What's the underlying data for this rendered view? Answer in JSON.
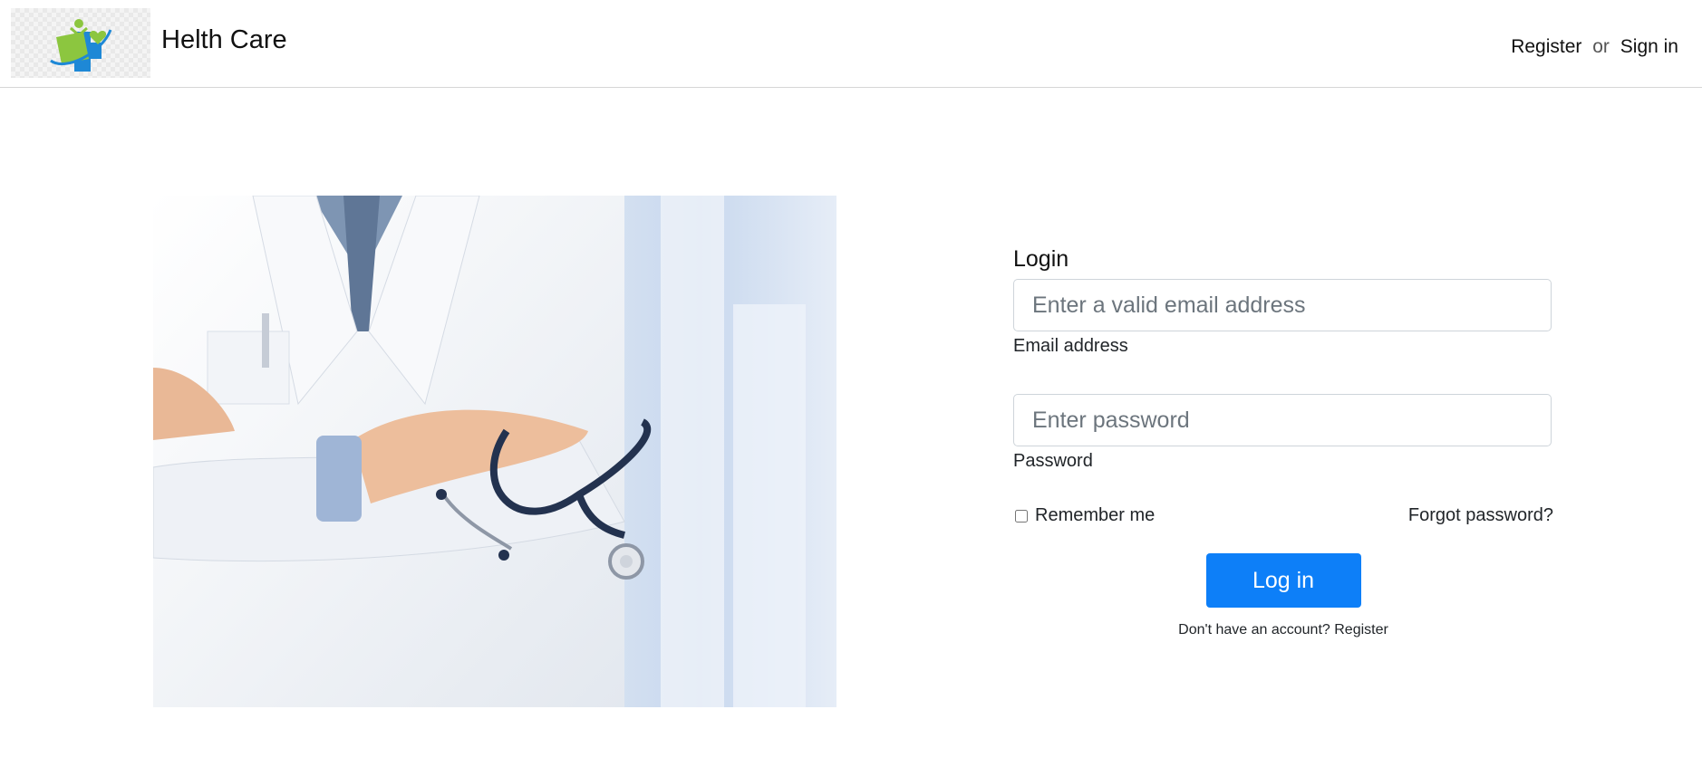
{
  "header": {
    "brand": "Helth Care",
    "nav": {
      "register": "Register",
      "or": "or",
      "sign_in": "Sign in"
    }
  },
  "login": {
    "title": "Login",
    "email": {
      "placeholder": "Enter a valid email address",
      "value": "",
      "label": "Email address"
    },
    "password": {
      "placeholder": "Enter password",
      "value": "",
      "label": "Password"
    },
    "remember_label": "Remember me",
    "remember_checked": false,
    "forgot": "Forgot password?",
    "submit": "Log in",
    "signup_prompt": "Don't have an account?",
    "signup_link": "Register"
  },
  "colors": {
    "primary": "#0d7ff8",
    "logo_green": "#8cc63f",
    "logo_blue": "#1e88d6"
  },
  "icons": {
    "logo": "health-care-logo-icon",
    "hero": "doctor-with-stethoscope-image"
  }
}
